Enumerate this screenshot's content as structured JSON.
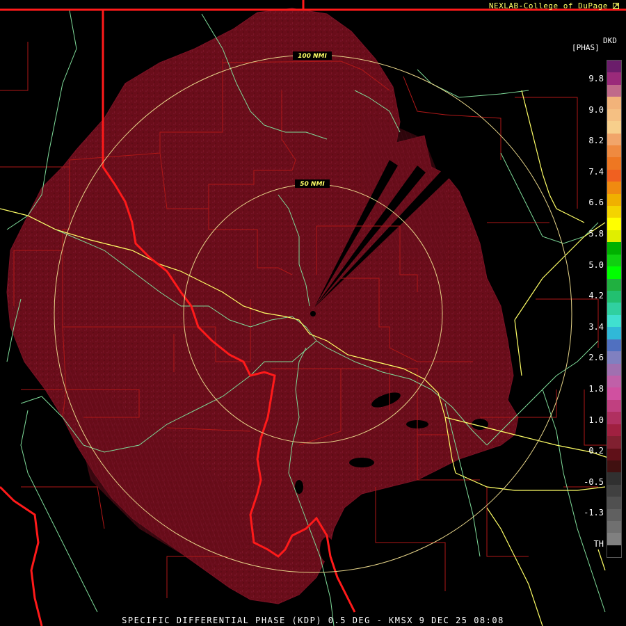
{
  "credit": "NEXLAB-College of DuPage",
  "credit_icon": "external-link-icon",
  "caption": "SPECIFIC DIFFERENTIAL PHASE (KDP) 0.5 DEG - KMSX 9 DEC 25 08:08",
  "rings": {
    "inner_label": "50 NMI",
    "outer_label": "100 NMI"
  },
  "legend": {
    "product": "DKD",
    "unit": "[PHAS]",
    "ticks": [
      "9.8",
      "9.0",
      "8.2",
      "7.4",
      "6.6",
      "5.8",
      "5.0",
      "4.2",
      "3.4",
      "2.6",
      "1.8",
      "1.0",
      "0.2",
      "-0.5",
      "-1.3",
      "TH"
    ],
    "colors": [
      "#6b1d6b",
      "#9a2a7a",
      "#c06a8a",
      "#f2b37a",
      "#f5c083",
      "#f7cf8c",
      "#f1a56a",
      "#ef8a40",
      "#ee7722",
      "#f06020",
      "#f08a10",
      "#f0b000",
      "#f4d400",
      "#ffff00",
      "#e0ee00",
      "#00b000",
      "#10d010",
      "#00ff00",
      "#20b040",
      "#22c070",
      "#30d0a0",
      "#40e0d0",
      "#30b8d8",
      "#5070c0",
      "#8080c0",
      "#a070b0",
      "#c060a8",
      "#d050a0",
      "#c04080",
      "#b03060",
      "#a02040",
      "#802030",
      "#601018",
      "#401010",
      "#303030",
      "#404040",
      "#505050",
      "#606060",
      "#707070",
      "#808080",
      "#000000"
    ],
    "colors_note": "scale palette top to bottom"
  },
  "colors": {
    "echo_fill": "#6a0d1a",
    "echo_edge": "#7a1224",
    "state_border": "#ff1a1a",
    "county_border": "#b01818",
    "river": "#7fdc9a",
    "highway": "#ffff66",
    "range_ring": "#e8d68a"
  }
}
